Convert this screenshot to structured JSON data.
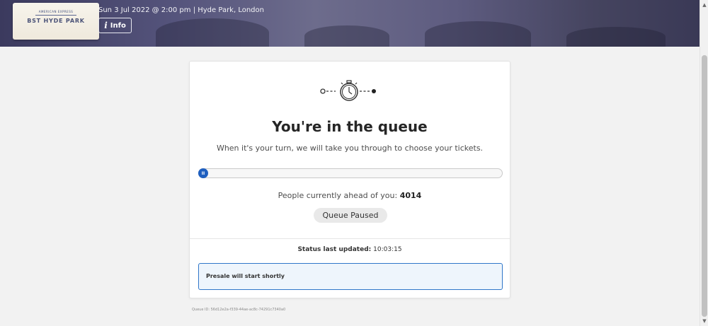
{
  "header": {
    "logo_top": "AMERICAN EXPRESS",
    "logo_main": "BST HYDE PARK",
    "event_details": "Sun 3 Jul 2022 @ 2:00 pm | Hyde Park, London",
    "info_label": "Info",
    "info_icon": "info-icon"
  },
  "queue": {
    "icon": "stopwatch-icon",
    "title": "You're in the queue",
    "subtitle": "When it's your turn, we will take you through to choose your tickets.",
    "progress": 0.0,
    "pause_icon": "pause-icon",
    "pause_symbol": "II",
    "ahead_label": "People currently ahead of you:",
    "ahead_count": "4014",
    "status_badge": "Queue Paused",
    "updated_label": "Status last updated:",
    "updated_time": "10:03:15",
    "notice": "Presale will start shortly"
  },
  "footer": {
    "queue_id": "Queue ID: 56d12e2a-f339-44ae-ac8c-74291c7340a0"
  },
  "colors": {
    "accent": "#1f5fbf",
    "notice_border": "#2f76c9",
    "notice_bg": "#eef5fc"
  }
}
